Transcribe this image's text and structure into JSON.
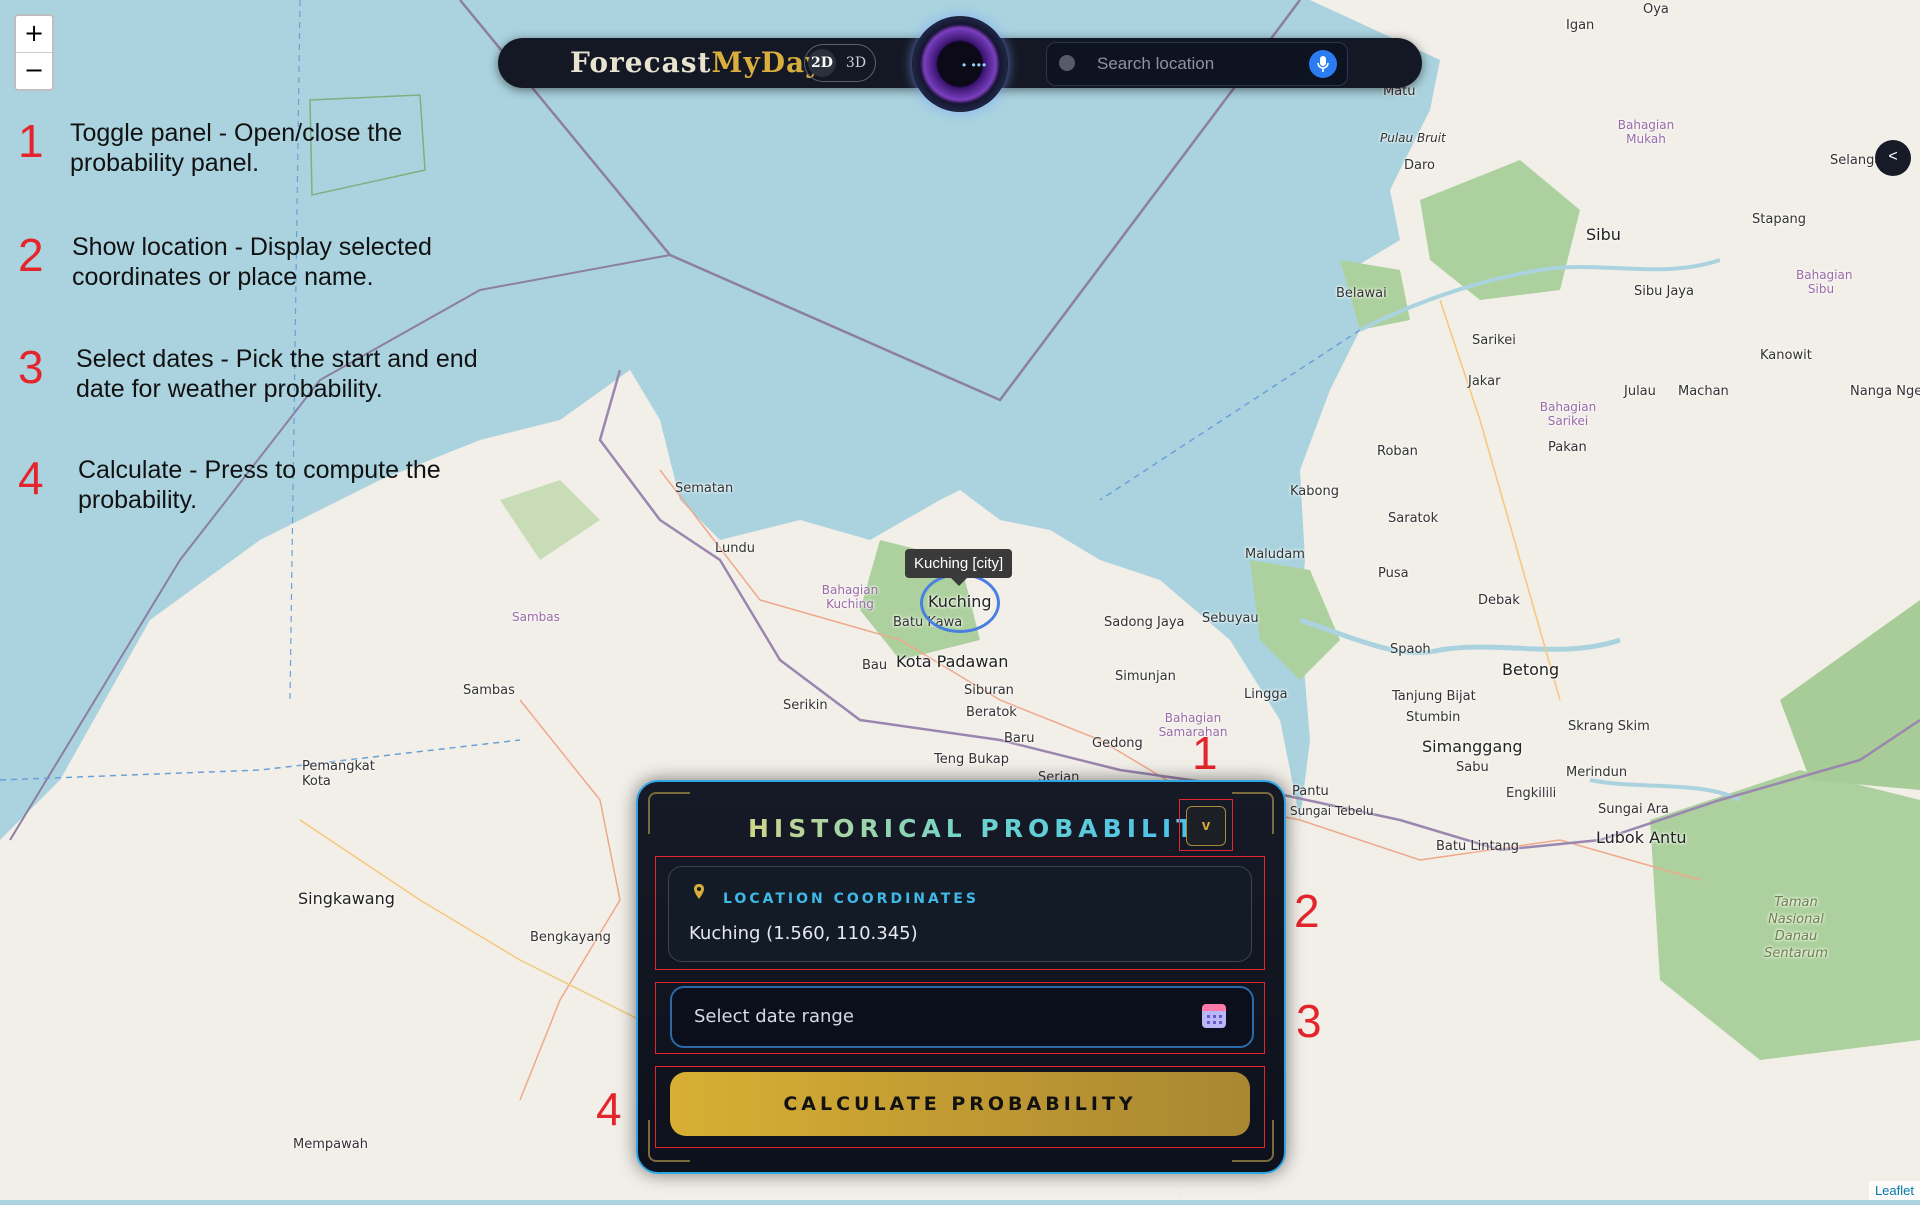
{
  "map": {
    "places": [
      {
        "name": "Igan"
      },
      {
        "name": "Oya"
      },
      {
        "name": "Matu"
      },
      {
        "name": "Bahagian Mukah"
      },
      {
        "name": "Pulau Bruit"
      },
      {
        "name": "Daro"
      },
      {
        "name": "Selanga"
      },
      {
        "name": "Stapang"
      },
      {
        "name": "Sibu"
      },
      {
        "name": "Bahagian Sibu"
      },
      {
        "name": "Belawai"
      },
      {
        "name": "Sibu Jaya"
      },
      {
        "name": "Sarikei"
      },
      {
        "name": "Kanowit"
      },
      {
        "name": "Jakar"
      },
      {
        "name": "Julau"
      },
      {
        "name": "Machan"
      },
      {
        "name": "Nanga Ngem"
      },
      {
        "name": "Bahagian Sarikei"
      },
      {
        "name": "Roban"
      },
      {
        "name": "Pakan"
      },
      {
        "name": "Sematan"
      },
      {
        "name": "Kabong"
      },
      {
        "name": "Lundu"
      },
      {
        "name": "Saratok"
      },
      {
        "name": "Maludam"
      },
      {
        "name": "Pusa"
      },
      {
        "name": "Debak"
      },
      {
        "name": "Bahagian Kuching"
      },
      {
        "name": "Sambas"
      },
      {
        "name": "Kuching"
      },
      {
        "name": "Batu Kawa"
      },
      {
        "name": "Sadong Jaya"
      },
      {
        "name": "Sebuyau"
      },
      {
        "name": "Spaoh"
      },
      {
        "name": "Betong"
      },
      {
        "name": "Bau"
      },
      {
        "name": "Kota Padawan"
      },
      {
        "name": "Simunjan"
      },
      {
        "name": "Lingga"
      },
      {
        "name": "Tanjung Bijat"
      },
      {
        "name": "Stumbin"
      },
      {
        "name": "Sambas"
      },
      {
        "name": "Serikin"
      },
      {
        "name": "Siburan"
      },
      {
        "name": "Beratok"
      },
      {
        "name": "Bahagian Samarahan"
      },
      {
        "name": "Skrang Skim"
      },
      {
        "name": "Simanggang"
      },
      {
        "name": "Baru"
      },
      {
        "name": "Gedong"
      },
      {
        "name": "Sabu"
      },
      {
        "name": "Pemangkat Kota"
      },
      {
        "name": "Teng Bukap"
      },
      {
        "name": "Serian"
      },
      {
        "name": "Pantu"
      },
      {
        "name": "Merindun"
      },
      {
        "name": "Engkilili"
      },
      {
        "name": "Sungai Ara"
      },
      {
        "name": "Sungai Tebelu"
      },
      {
        "name": "Lubok Antu"
      },
      {
        "name": "Batu Lintang"
      },
      {
        "name": "Singkawang"
      },
      {
        "name": "Bengkayang"
      },
      {
        "name": "Taman Nasional Danau Sentarum"
      },
      {
        "name": "Mempawah"
      }
    ],
    "tooltip": "Kuching [city]",
    "attribution": "Leaflet"
  },
  "zoom": {
    "in": "+",
    "out": "−"
  },
  "annotations": [
    {
      "num": "1",
      "text": "Toggle panel - Open/close the probability panel."
    },
    {
      "num": "2",
      "text": "Show location - Display selected coordinates or place name."
    },
    {
      "num": "3",
      "text": "Select dates - Pick the start and end date for weather probability."
    },
    {
      "num": "4",
      "text": "Calculate - Press to compute the probability."
    }
  ],
  "topbar": {
    "logo_a": "Forecast",
    "logo_b": "MyDay",
    "mode_2d": "2D",
    "mode_3d": "3D",
    "orb_dots": "• •••",
    "search_placeholder": "Search location"
  },
  "side_button": "<",
  "panel": {
    "title": "HISTORICAL PROBABILITY",
    "collapse_label": "v",
    "location_label": "LOCATION COORDINATES",
    "location_value": "Kuching (1.560, 110.345)",
    "date_placeholder": "Select date range",
    "calculate_label": "CALCULATE PROBABILITY"
  },
  "callouts": {
    "one": "1",
    "two": "2",
    "three": "3",
    "four": "4"
  },
  "colors": {
    "accent_blue": "#2ea6e6",
    "gold": "#d9ae3c",
    "annotation_red": "#e4262c",
    "sea": "#aad3df",
    "land": "#f2efe9"
  }
}
